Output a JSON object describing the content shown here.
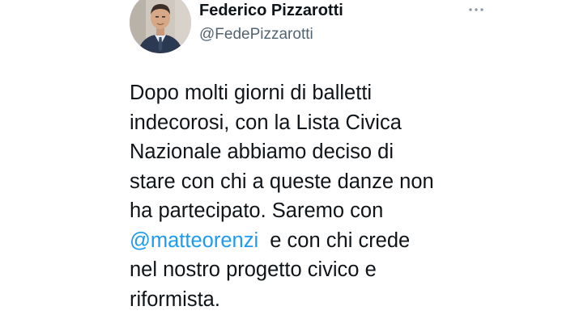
{
  "author": {
    "display_name": "Federico Pizzarotti",
    "handle": "@FedePizzarotti",
    "avatar_icon": "profile-photo"
  },
  "menu": {
    "icon": "more-horizontal-icon"
  },
  "tweet": {
    "line1": "Dopo molti giorni di balletti",
    "line2": "indecorosi, con la Lista Civica",
    "line3": "Nazionale abbiamo deciso di",
    "line4": "stare con chi a queste danze non",
    "line5": "ha partecipato. Saremo con",
    "mention": "@matteorenzi",
    "line6_rest": "  e con chi crede",
    "line7": "nel nostro progetto civico e",
    "line8": "riformista."
  },
  "colors": {
    "text": "#0f1419",
    "secondary": "#536471",
    "link": "#1d9bf0",
    "background": "#ffffff"
  }
}
